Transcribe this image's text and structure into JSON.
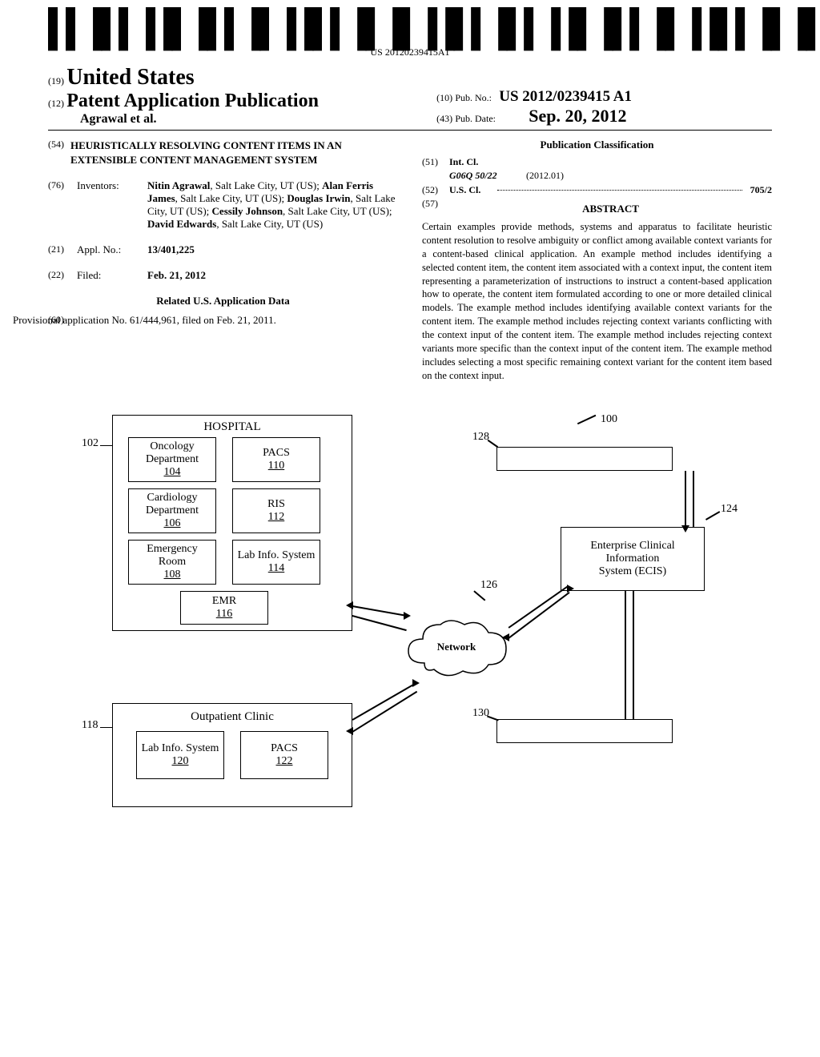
{
  "barcode": {
    "number": "US 20120239415A1"
  },
  "header": {
    "prefix19": "(19)",
    "country": "United States",
    "prefix12": "(12)",
    "pubAppLabel": "Patent Application Publication",
    "authors": "Agrawal et al.",
    "pubNo": {
      "prefix": "(10)",
      "label": "Pub. No.:",
      "value": "US 2012/0239415 A1"
    },
    "pubDate": {
      "prefix": "(43)",
      "label": "Pub. Date:",
      "value": "Sep. 20, 2012"
    }
  },
  "title": {
    "num": "(54)",
    "text": "HEURISTICALLY RESOLVING CONTENT ITEMS IN AN EXTENSIBLE CONTENT MANAGEMENT SYSTEM"
  },
  "inventors": {
    "num": "(76)",
    "label": "Inventors:",
    "names": [
      {
        "name": "Nitin Agrawal",
        "loc": ", Salt Lake City, UT (US); "
      },
      {
        "name": "Alan Ferris James",
        "loc": ", Salt Lake City, UT (US); "
      },
      {
        "name": "Douglas Irwin",
        "loc": ", Salt Lake City, UT (US); "
      },
      {
        "name": "Cessily Johnson",
        "loc": ", Salt Lake City, UT (US); "
      },
      {
        "name": "David Edwards",
        "loc": ", Salt Lake City, UT (US)"
      }
    ]
  },
  "applNo": {
    "num": "(21)",
    "label": "Appl. No.:",
    "value": "13/401,225"
  },
  "filed": {
    "num": "(22)",
    "label": "Filed:",
    "value": "Feb. 21, 2012"
  },
  "related": {
    "heading": "Related U.S. Application Data",
    "num": "(60)",
    "text": "Provisional application No. 61/444,961, filed on Feb. 21, 2011."
  },
  "classification": {
    "heading": "Publication Classification",
    "intcl": {
      "num": "(51)",
      "label": "Int. Cl.",
      "code": "G06Q 50/22",
      "year": "(2012.01)"
    },
    "uscls": {
      "num": "(52)",
      "label": "U.S. Cl.",
      "value": "705/2"
    }
  },
  "abstract": {
    "num": "(57)",
    "heading": "ABSTRACT",
    "text": "Certain examples provide methods, systems and apparatus to facilitate heuristic content resolution to resolve ambiguity or conflict among available context variants for a content-based clinical application. An example method includes identifying a selected content item, the content item associated with a context input, the content item representing a parameterization of instructions to instruct a content-based application how to operate, the content item formulated according to one or more detailed clinical models. The example method includes identifying available context variants for the content item. The example method includes rejecting context variants conflicting with the context input of the content item. The example method includes rejecting context variants more specific than the context input of the content item. The example method includes selecting a most specific remaining context variant for the content item based on the context input."
  },
  "diagram": {
    "hospital": "HOSPITAL",
    "oncology": "Oncology Department",
    "oncologyNum": "104",
    "pacs": "PACS",
    "pacsNum": "110",
    "cardiology": "Cardiology Department",
    "cardiologyNum": "106",
    "ris": "RIS",
    "risNum": "112",
    "emergency": "Emergency Room",
    "emergencyNum": "108",
    "lab": "Lab Info. System",
    "labNum": "114",
    "emr": "EMR",
    "emrNum": "116",
    "outpatient": "Outpatient Clinic",
    "lab2": "Lab Info. System",
    "lab2Num": "120",
    "pacs2": "PACS",
    "pacs2Num": "122",
    "network": "Network",
    "ecis1": "Enterprise Clinical",
    "ecis2": "Information",
    "ecis3": "System (ECIS)",
    "ref100": "100",
    "ref102": "102",
    "ref118": "118",
    "ref124": "124",
    "ref126": "126",
    "ref128": "128",
    "ref130": "130"
  }
}
